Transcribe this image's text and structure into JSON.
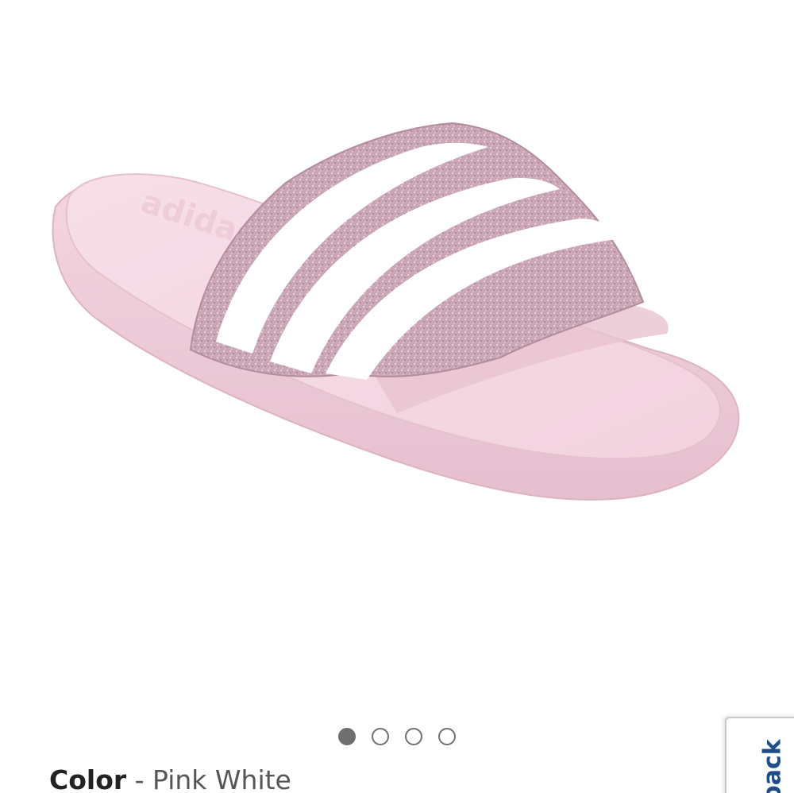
{
  "product": {
    "image_alt": "Pink slide sandal with three white stripes on a glitter strap",
    "colors": {
      "sole": "#f0cfdc",
      "footbed": "#f6dbe5",
      "strap_glitter": "#c9a3b3",
      "stripe": "#ffffff"
    }
  },
  "carousel": {
    "total": 4,
    "active_index": 0
  },
  "color_selection": {
    "label": "Color",
    "separator": " - ",
    "value": "Pink White"
  },
  "feedback_tab": {
    "label": "back"
  }
}
